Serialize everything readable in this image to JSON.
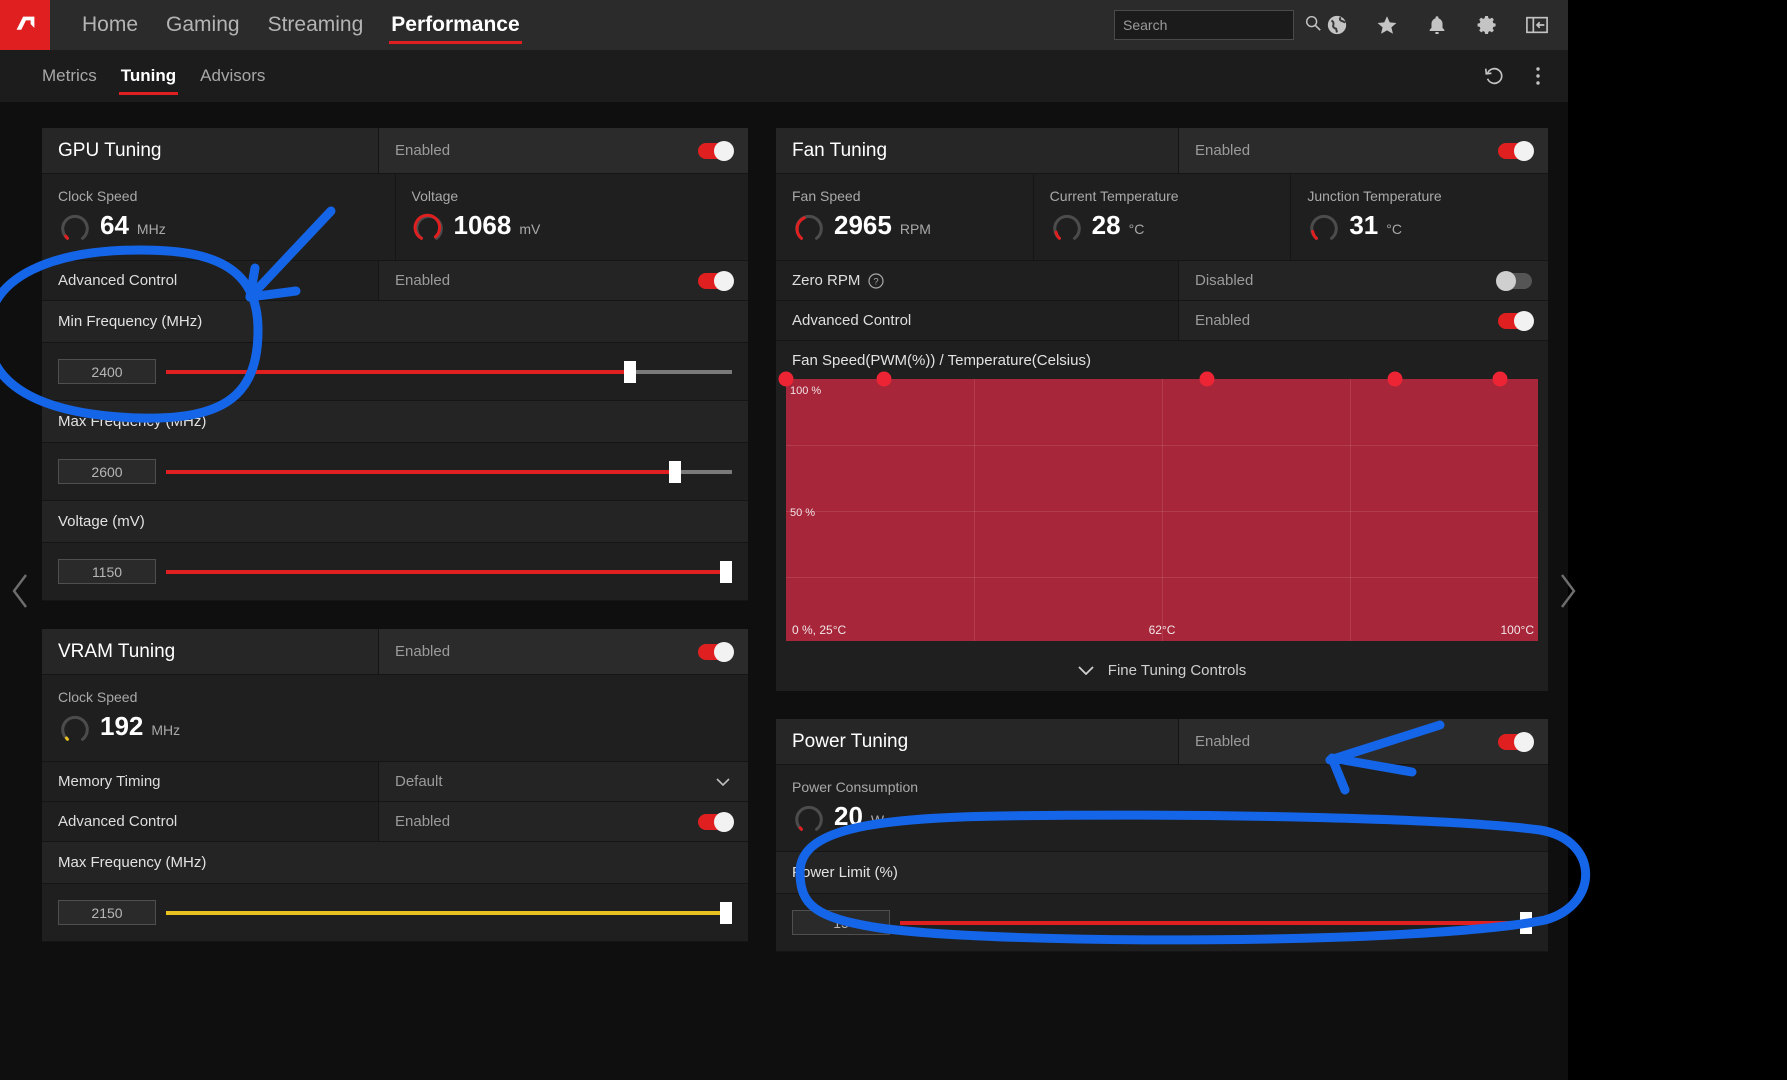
{
  "topbar": {
    "logo_icon": "amd-logo-icon",
    "nav": [
      {
        "label": "Home",
        "active": false
      },
      {
        "label": "Gaming",
        "active": false
      },
      {
        "label": "Streaming",
        "active": false
      },
      {
        "label": "Performance",
        "active": true
      }
    ],
    "search": {
      "placeholder": "Search",
      "value": "",
      "icon": "search-icon"
    },
    "icons": [
      "globe-icon",
      "star-icon",
      "bell-icon",
      "gear-icon",
      "panel-collapse-icon"
    ]
  },
  "subbar": {
    "tabs": [
      {
        "label": "Metrics",
        "active": false
      },
      {
        "label": "Tuning",
        "active": true
      },
      {
        "label": "Advisors",
        "active": false
      }
    ],
    "reset_icon": "undo-reset-icon",
    "more_icon": "kebab-menu-icon"
  },
  "gpu_tuning": {
    "title": "GPU Tuning",
    "status": "Enabled",
    "toggle_on": true,
    "metrics": [
      {
        "caption": "Clock Speed",
        "value": "64",
        "unit": "MHz",
        "ring_pct": 6,
        "ring_color": "#e02020"
      },
      {
        "caption": "Voltage",
        "value": "1068",
        "unit": "mV",
        "ring_pct": 72,
        "ring_color": "#e02020"
      }
    ],
    "advanced_control": {
      "label": "Advanced Control",
      "status": "Enabled",
      "toggle_on": true
    },
    "sliders": [
      {
        "label": "Min Frequency (MHz)",
        "value": "2400",
        "pct": 82,
        "color": "#e02020"
      },
      {
        "label": "Max Frequency (MHz)",
        "value": "2600",
        "pct": 90,
        "color": "#e02020"
      },
      {
        "label": "Voltage (mV)",
        "value": "1150",
        "pct": 99,
        "color": "#e02020"
      }
    ]
  },
  "vram_tuning": {
    "title": "VRAM Tuning",
    "status": "Enabled",
    "toggle_on": true,
    "metrics": [
      {
        "caption": "Clock Speed",
        "value": "192",
        "unit": "MHz",
        "ring_pct": 4,
        "ring_color": "#e8c020"
      }
    ],
    "memory_timing": {
      "label": "Memory Timing",
      "value": "Default"
    },
    "advanced_control": {
      "label": "Advanced Control",
      "status": "Enabled",
      "toggle_on": true
    },
    "sliders": [
      {
        "label": "Max Frequency (MHz)",
        "value": "2150",
        "pct": 99,
        "color": "#e8c020"
      }
    ]
  },
  "fan_tuning": {
    "title": "Fan Tuning",
    "status": "Enabled",
    "toggle_on": true,
    "metrics": [
      {
        "caption": "Fan Speed",
        "value": "2965",
        "unit": "RPM",
        "ring_pct": 60,
        "ring_color": "#e02020"
      },
      {
        "caption": "Current Temperature",
        "value": "28",
        "unit": "°C",
        "ring_pct": 14,
        "ring_color": "#e02020"
      },
      {
        "caption": "Junction Temperature",
        "value": "31",
        "unit": "°C",
        "ring_pct": 16,
        "ring_color": "#e02020"
      }
    ],
    "zero_rpm": {
      "label": "Zero RPM",
      "status": "Disabled",
      "toggle_on": false,
      "help_icon": "question-circle-icon"
    },
    "advanced_control": {
      "label": "Advanced Control",
      "status": "Enabled",
      "toggle_on": true
    },
    "fine_tuning_controls": {
      "label": "Fine Tuning Controls",
      "icon": "chevron-down-icon"
    }
  },
  "chart_data": {
    "type": "line",
    "title": "Fan Speed(PWM(%)) / Temperature(Celsius)",
    "xlabel": "Temperature(Celsius)",
    "ylabel": "Fan Speed(PWM(%))",
    "xlim": [
      25,
      100
    ],
    "ylim": [
      0,
      100
    ],
    "y_ticks": [
      "100 %",
      "50 %"
    ],
    "x_ticks": [
      "0 %, 25°C",
      "62°C",
      "100°C"
    ],
    "grid": true,
    "series": [
      {
        "name": "Fan Curve",
        "x": [
          25,
          43,
          62,
          79,
          93
        ],
        "y": [
          100,
          100,
          100,
          100,
          100
        ]
      }
    ],
    "point_color": "#ed2434",
    "fill_color": "#a7263a"
  },
  "power_tuning": {
    "title": "Power Tuning",
    "status": "Enabled",
    "toggle_on": true,
    "metrics": [
      {
        "caption": "Power Consumption",
        "value": "20",
        "unit": "W",
        "ring_pct": 5,
        "ring_color": "#e02020"
      }
    ],
    "sliders": [
      {
        "label": "Power Limit (%)",
        "value": "15",
        "pct": 99,
        "color": "#e02020"
      }
    ]
  },
  "pager": {
    "left_icon": "chevron-left-icon",
    "right_icon": "chevron-right-icon"
  },
  "annotations": {
    "color": "#1565e8",
    "marks": [
      {
        "type": "circle-highlight",
        "target": "min-frequency-slider-region"
      },
      {
        "type": "arrow",
        "target": "gpu-advanced-control-row"
      },
      {
        "type": "arrow",
        "target": "power-tuning-enabled-toggle"
      },
      {
        "type": "circle-highlight",
        "target": "power-limit-slider-region"
      }
    ]
  }
}
